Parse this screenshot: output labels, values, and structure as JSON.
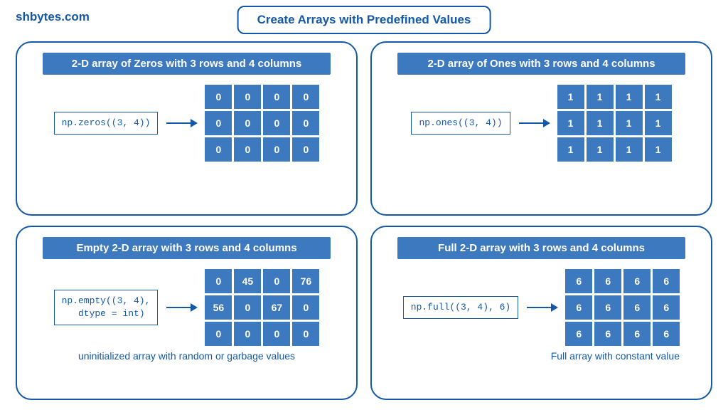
{
  "logo": "shbytes.com",
  "title": "Create Arrays with Predefined Values",
  "panels": {
    "zeros": {
      "title": "2-D array of Zeros with 3 rows and 4 columns",
      "code": "np.zeros((3, 4))",
      "matrix": [
        [
          0,
          0,
          0,
          0
        ],
        [
          0,
          0,
          0,
          0
        ],
        [
          0,
          0,
          0,
          0
        ]
      ]
    },
    "ones": {
      "title": "2-D array of Ones with 3 rows and 4 columns",
      "code": "np.ones((3, 4))",
      "matrix": [
        [
          1,
          1,
          1,
          1
        ],
        [
          1,
          1,
          1,
          1
        ],
        [
          1,
          1,
          1,
          1
        ]
      ]
    },
    "empty": {
      "title": "Empty 2-D array with 3 rows and 4 columns",
      "code": "np.empty((3, 4),\n  dtype = int)",
      "matrix": [
        [
          0,
          45,
          0,
          76
        ],
        [
          56,
          0,
          67,
          0
        ],
        [
          0,
          0,
          0,
          0
        ]
      ],
      "caption": "uninitialized array with random\nor garbage values"
    },
    "full": {
      "title": "Full 2-D array with 3 rows and 4 columns",
      "code": "np.full((3, 4), 6)",
      "matrix": [
        [
          6,
          6,
          6,
          6
        ],
        [
          6,
          6,
          6,
          6
        ],
        [
          6,
          6,
          6,
          6
        ]
      ],
      "caption": "Full array with constant value"
    }
  }
}
